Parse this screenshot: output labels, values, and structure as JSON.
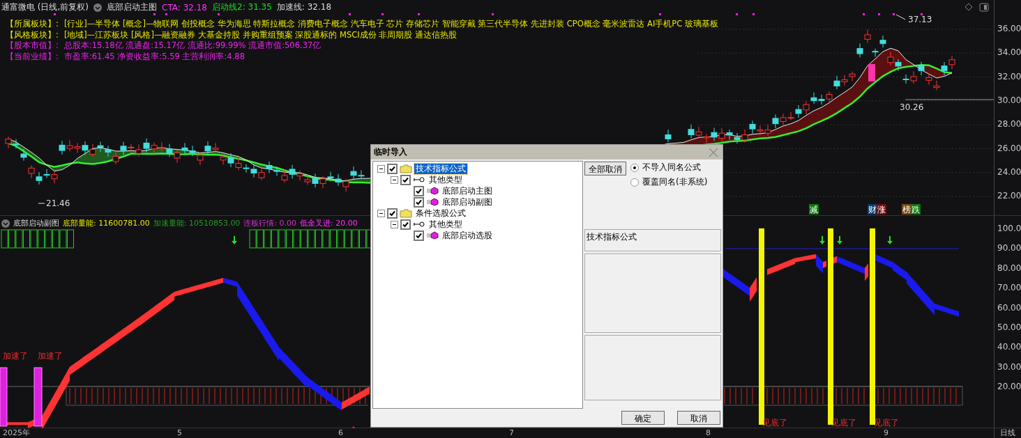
{
  "main_header": {
    "title": "通富微电 (日线,前复权)",
    "indicator": "底部启动主图",
    "readings": [
      {
        "text": "CTA: 32.18",
        "color": "#ff33ff"
      },
      {
        "text": "启动线2: 31.35",
        "color": "#22dd22"
      },
      {
        "text": "加速线: 32.18",
        "color": "#dddddd"
      }
    ]
  },
  "info_lines": [
    {
      "label": "【所属板块】:",
      "text": "[行业]—半导体 [概念]—物联网 创投概念 华为海思 特斯拉概念 消费电子概念 汽车电子 芯片 存储芯片 智能穿戴 第三代半导体 先进封装 CPO概念 毫米波雷达 AI手机PC 玻璃基板",
      "color": "#e6e600"
    },
    {
      "label": "【风格板块】:",
      "text": "[地域]—江苏板块 [风格]—融资融券 大基金持股 并购重组预案 深股通标的 MSCI成份 非周期股 通达信热股",
      "color": "#e6e600"
    },
    {
      "label": "【股本市值】:",
      "text": "总股本:15.18亿 流通盘:15.17亿 流通比:99.99% 流通市值:506.37亿",
      "color": "#ee22ee"
    },
    {
      "label": "【当前业绩】:",
      "text": "市盈率:61.45 净资收益率:5.59 主营利润率:4.88",
      "color": "#ee22ee"
    }
  ],
  "price_marks": [
    "37.13",
    "30.26",
    "21.46"
  ],
  "main_axis_ticks": [
    "36.00",
    "34.00",
    "32.00",
    "30.00",
    "28.00",
    "26.00",
    "24.00",
    "22.00"
  ],
  "event_badges": [
    {
      "text": "减",
      "color": "#0a7a0a"
    },
    {
      "text": "财",
      "color": "#0a3a6e"
    },
    {
      "text": "涨",
      "color": "#7a0a0a"
    },
    {
      "text": "榜",
      "color": "#7a4510"
    },
    {
      "text": "跌",
      "color": "#0a7a0a"
    }
  ],
  "sub_header": {
    "indicator": "底部启动副图",
    "readings": [
      {
        "text": "底部量能: 11600781.00",
        "color": "#e6e600"
      },
      {
        "text": "加速量能: 10510853.00",
        "color": "#229922"
      },
      {
        "text": "连板行情: 0.00",
        "color": "#cc33cc"
      },
      {
        "text": "低金叉进: 20.00",
        "color": "#ff33ff"
      }
    ]
  },
  "sub_axis_ticks": [
    "100.0",
    "90.00",
    "80.00",
    "70.00",
    "60.00",
    "50.00",
    "40.00",
    "30.00",
    "20.00"
  ],
  "signals": [
    {
      "text": "加速了"
    },
    {
      "text": "加速了"
    },
    {
      "text": "见底了"
    },
    {
      "text": "见底了"
    },
    {
      "text": "见底了"
    }
  ],
  "x_axis": {
    "labels": [
      "2025年",
      "5",
      "6",
      "7",
      "8",
      "9"
    ],
    "period": "日线"
  },
  "dialog": {
    "title": "临时导入",
    "tree": [
      {
        "label": "技术指标公式",
        "kind": "folder",
        "checked": true,
        "expanded": true,
        "selected": true,
        "children": [
          {
            "label": "其他类型",
            "kind": "key",
            "checked": true,
            "expanded": true,
            "selected": false,
            "children": [
              {
                "label": "底部启动主图",
                "kind": "formula",
                "checked": true,
                "selected": false
              },
              {
                "label": "底部启动副图",
                "kind": "formula",
                "checked": true,
                "selected": false
              }
            ]
          }
        ]
      },
      {
        "label": "条件选股公式",
        "kind": "folder",
        "checked": true,
        "expanded": true,
        "selected": false,
        "children": [
          {
            "label": "其他类型",
            "kind": "key",
            "checked": true,
            "expanded": true,
            "selected": false,
            "children": [
              {
                "label": "底部启动选股",
                "kind": "formula",
                "checked": true,
                "selected": false
              }
            ]
          }
        ]
      }
    ],
    "cancel_all_button": "全部取消",
    "options": [
      {
        "label": "不导入同名公式",
        "selected": true
      },
      {
        "label": "覆盖同名(非系统)",
        "selected": false
      }
    ],
    "description": "技术指标公式",
    "buttons": [
      "确定",
      "取消"
    ]
  }
}
